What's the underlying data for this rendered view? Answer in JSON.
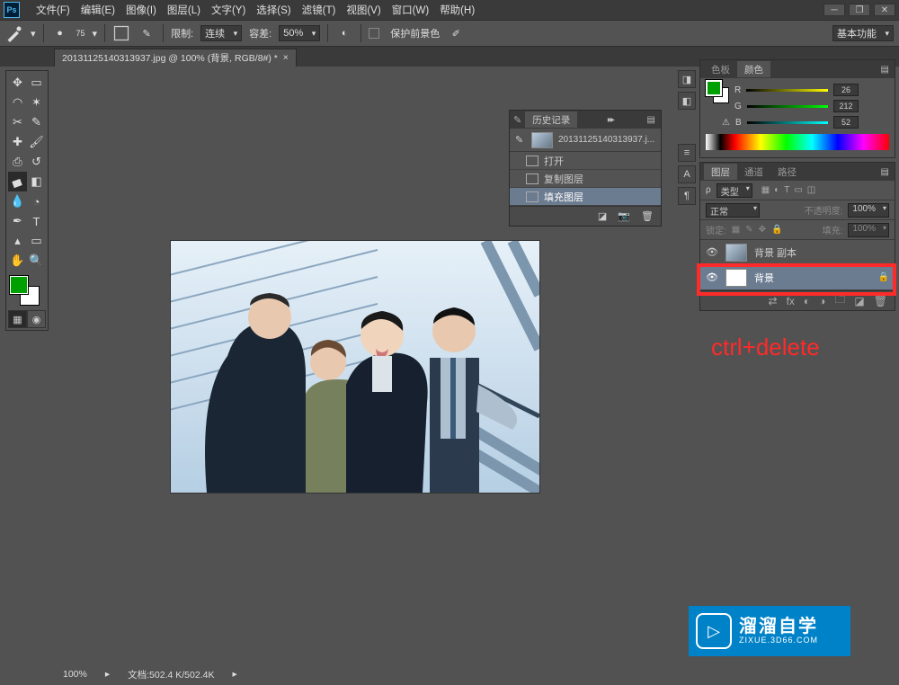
{
  "menu": [
    "文件(F)",
    "编辑(E)",
    "图像(I)",
    "图层(L)",
    "文字(Y)",
    "选择(S)",
    "滤镜(T)",
    "视图(V)",
    "窗口(W)",
    "帮助(H)"
  ],
  "options": {
    "brush_size": "75",
    "limit_label": "限制:",
    "limit_value": "连续",
    "tolerance_label": "容差:",
    "tolerance_value": "50%",
    "protect_label": "保护前景色",
    "workspace": "基本功能"
  },
  "tab": {
    "title": "20131125140313937.jpg @ 100% (背景, RGB/8#) *"
  },
  "status": {
    "zoom": "100%",
    "doc": "文档:502.4 K/502.4K"
  },
  "history": {
    "title": "历史记录",
    "snapshot": "20131125140313937.j...",
    "items": [
      "打开",
      "复制图层",
      "填充图层"
    ],
    "selected": 2
  },
  "color_panel": {
    "tabs": [
      "色板",
      "颜色"
    ],
    "rgb": {
      "R": "26",
      "G": "212",
      "B": "52"
    }
  },
  "layers_panel": {
    "tabs": [
      "图层",
      "通道",
      "路径"
    ],
    "kind": "类型",
    "blend": "正常",
    "opacity_label": "不透明度:",
    "opacity": "100%",
    "lock_label": "锁定:",
    "fill_label": "填充:",
    "fill": "100%",
    "layers": [
      {
        "name": "背景 副本",
        "locked": false,
        "selected": false,
        "thumb": "img"
      },
      {
        "name": "背景",
        "locked": true,
        "selected": true,
        "thumb": "white"
      }
    ]
  },
  "annotation": {
    "text": "ctrl+delete"
  },
  "watermark": {
    "big": "溜溜自学",
    "small": "ZIXUE.3D66.COM"
  }
}
